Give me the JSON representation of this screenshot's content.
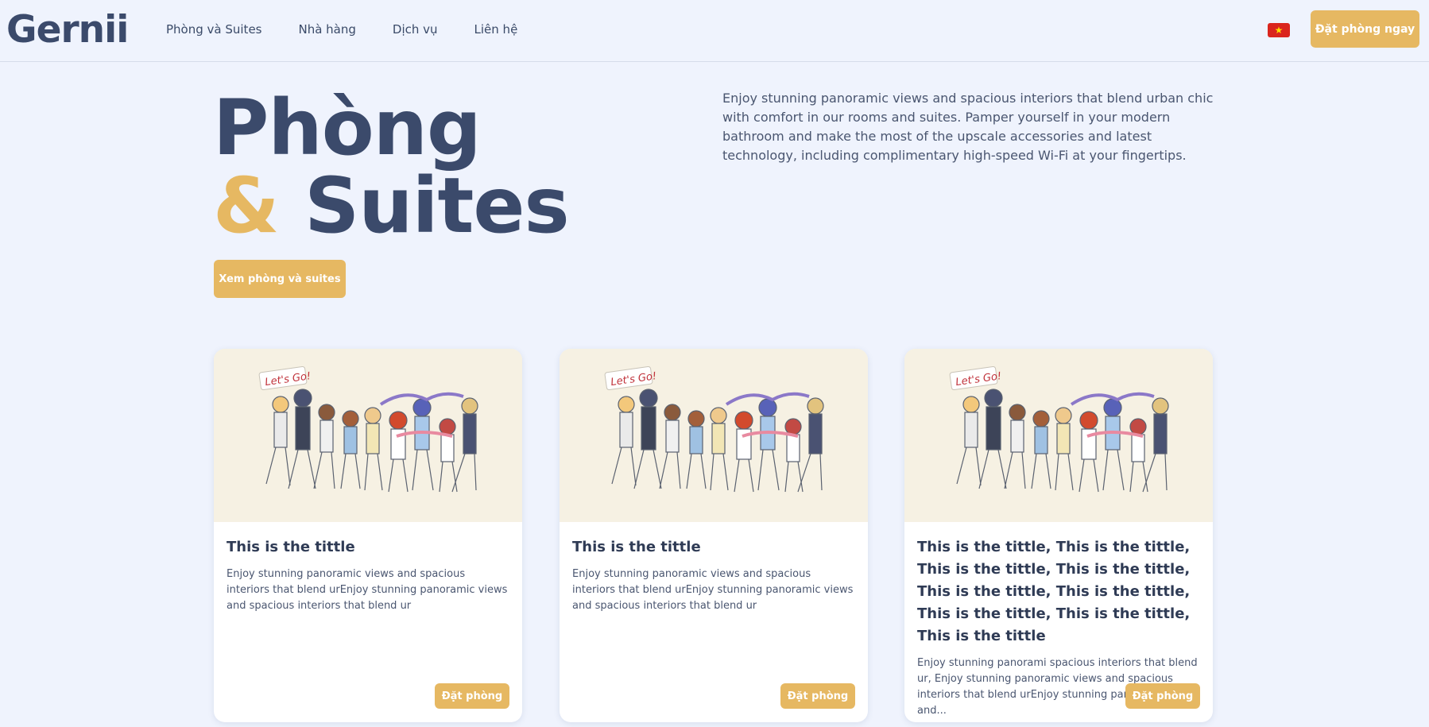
{
  "header": {
    "logo": "Gernii",
    "nav": [
      "Phòng và Suites",
      "Nhà hàng",
      "Dịch vụ",
      "Liên hệ"
    ],
    "book_now": "Đặt phòng ngay",
    "flag_icon": "vietnam-flag-icon"
  },
  "hero": {
    "title_line1": "Phòng",
    "title_amp": "&",
    "title_line2": "Suites",
    "description": "Enjoy stunning panoramic views and spacious interiors that blend urban chic with comfort in our rooms and suites. Pamper yourself in your modern bathroom and make the most of the upscale accessories and latest technology, including complimentary high-speed Wi-Fi at your fingertips.",
    "cta": "Xem phòng và suites"
  },
  "cards": [
    {
      "title": "This is the tittle",
      "text": "Enjoy stunning panoramic views and spacious interiors that blend urEnjoy stunning panoramic views and spacious interiors that blend ur",
      "button": "Đặt phòng",
      "image_text": "Let's Go!"
    },
    {
      "title": "This is the tittle",
      "text": "Enjoy stunning panoramic views and spacious interiors that blend urEnjoy stunning panoramic views and spacious interiors that blend ur",
      "button": "Đặt phòng",
      "image_text": "Let's Go!"
    },
    {
      "title": "This is the tittle, This is the tittle, This is the tittle, This is the tittle, This is the tittle, This is the tittle, This is the tittle, This is the tittle, This is the tittle",
      "text": "Enjoy stunning panorami spacious interiors that blend ur, Enjoy stunning panoramic views and spacious interiors that blend urEnjoy stunning panoramic views and...",
      "button": "Đặt phòng",
      "image_text": "Let's Go!"
    }
  ],
  "colors": {
    "accent": "#e6b862",
    "primary_text": "#3b4a6b",
    "background": "#eff3fd"
  }
}
